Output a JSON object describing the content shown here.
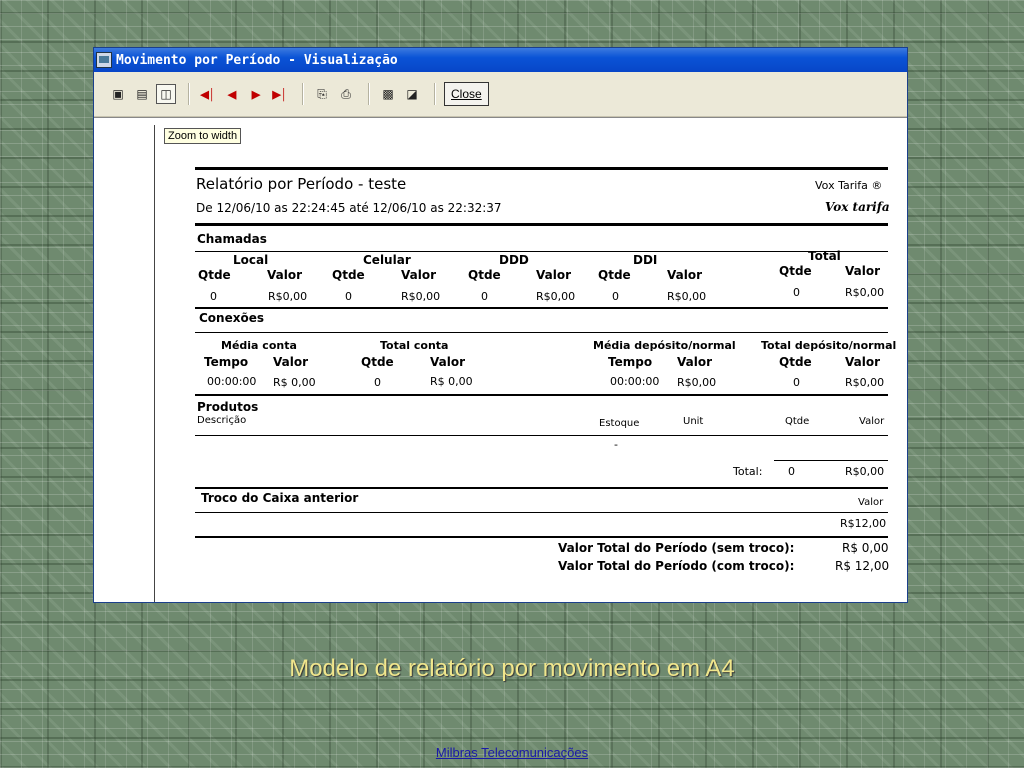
{
  "window": {
    "title": "Movimento por Período - Visualização"
  },
  "toolbar": {
    "close_label": "Close"
  },
  "tooltip": "Zoom to width",
  "report": {
    "title": "Relatório por Período - teste",
    "brand_top": "Vox Tarifa ®",
    "subtitle": "De  12/06/10 as 22:24:45 até 12/06/10 as 22:32:37",
    "brand_logo": "Vox tarifa",
    "chamadas": {
      "section": "Chamadas",
      "groups": [
        "Local",
        "Celular",
        "DDD",
        "DDI",
        "Total"
      ],
      "qtde": "Qtde",
      "valor": "Valor",
      "values": [
        "0",
        "R$0,00",
        "0",
        "R$0,00",
        "0",
        "R$0,00",
        "0",
        "R$0,00",
        "0",
        "R$0,00"
      ]
    },
    "conexoes": {
      "section": "Conexões",
      "media_conta": "Média conta",
      "total_conta": "Total conta",
      "media_deposito": "Média depósito/normal",
      "total_deposito": "Total depósito/normal",
      "tempo": "Tempo",
      "valor": "Valor",
      "qtde": "Qtde",
      "values": [
        "00:00:00",
        "R$ 0,00",
        "0",
        "R$ 0,00",
        "00:00:00",
        "R$0,00",
        "0",
        "R$0,00"
      ]
    },
    "produtos": {
      "section": "Produtos",
      "descricao": "Descrição",
      "estoque": "Estoque",
      "unit": "Unit",
      "qtde": "Qtde",
      "valor": "Valor",
      "dash": "-",
      "total_label": "Total:",
      "total_qtde": "0",
      "total_valor": "R$0,00"
    },
    "troco": {
      "section": "Troco do Caixa anterior",
      "valor_label": "Valor",
      "valor": "R$12,00"
    },
    "totais": {
      "sem_label": "Valor Total do Período (sem troco):",
      "sem_valor": "R$ 0,00",
      "com_label": "Valor Total do Período (com troco):",
      "com_valor": "R$ 12,00"
    }
  },
  "caption": "Modelo de relatório por movimento em A4",
  "footer": "Milbras Telecomunicações"
}
